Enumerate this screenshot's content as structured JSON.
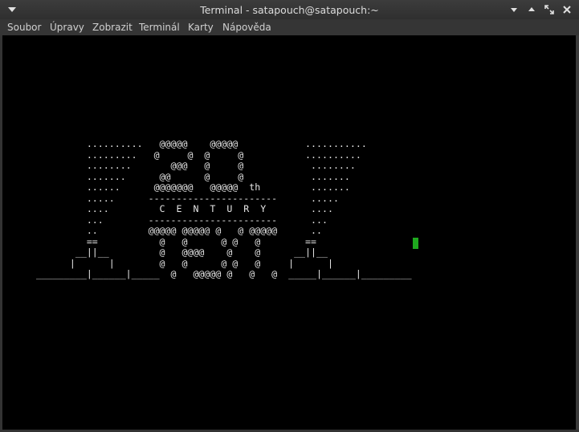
{
  "window": {
    "title": "Terminal - satapouch@satapouch:~"
  },
  "menu": {
    "items": [
      "Soubor",
      "Úpravy",
      "Zobrazit",
      "Terminál",
      "Karty",
      "Nápověda"
    ]
  },
  "terminal": {
    "lines": [
      "         ..........   @@@@@    @@@@@            ...........",
      "         .........   @     @  @     @           ..........",
      "         ........       @@@   @     @            ........",
      "         .......      @@      @     @            .......",
      "         ......      @@@@@@@   @@@@@  th         .......",
      "         .....      -----------------------      .....",
      "         ....         C  E  N  T  U  R  Y        ....",
      "         ...        -----------------------      ...",
      "         ..         @@@@@ @@@@@ @   @ @@@@@      ..",
      "         ==           @   @      @ @   @        ==",
      "       __||__         @   @@@@    @    @      __||__",
      "      |      |        @   @      @ @   @     |      |",
      "_________|______|_____  @   @@@@@ @   @   @  _____|______|_________"
    ],
    "cursor_color": "#1ea81e"
  },
  "colors": {
    "background": "#000000",
    "foreground": "#e6e6e6",
    "chrome": "#333333"
  }
}
